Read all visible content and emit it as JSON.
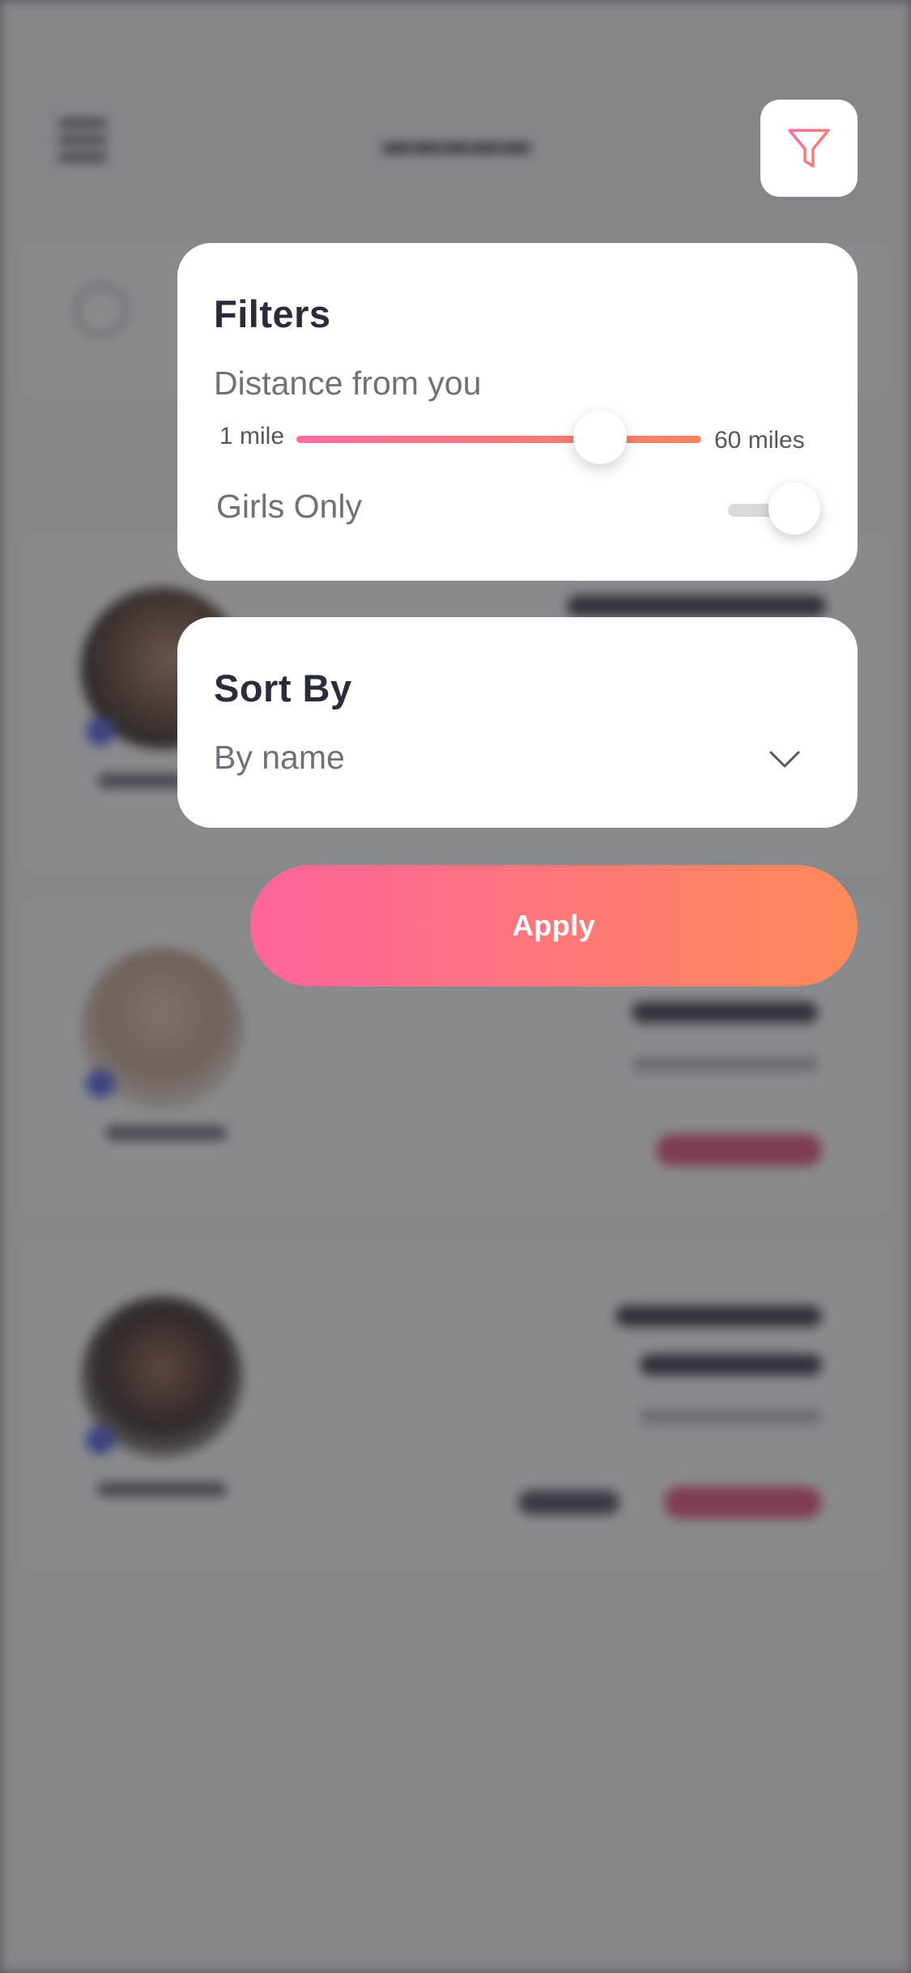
{
  "filters": {
    "title": "Filters",
    "distance_label": "Distance from you",
    "distance_min_label": "1 mile",
    "distance_max_label": "60 miles",
    "distance_value_fraction": 0.75,
    "girls_only_label": "Girls Only",
    "girls_only_on": true
  },
  "sort": {
    "title": "Sort By",
    "selected": "By name"
  },
  "apply_label": "Apply",
  "icons": {
    "filter": "filter-funnel-icon",
    "chevron": "chevron-down-icon"
  },
  "colors": {
    "accent_start": "#ff649d",
    "accent_end": "#fe8a58",
    "overlay": "#8a8b8e",
    "title_text": "#2a2c3c"
  }
}
